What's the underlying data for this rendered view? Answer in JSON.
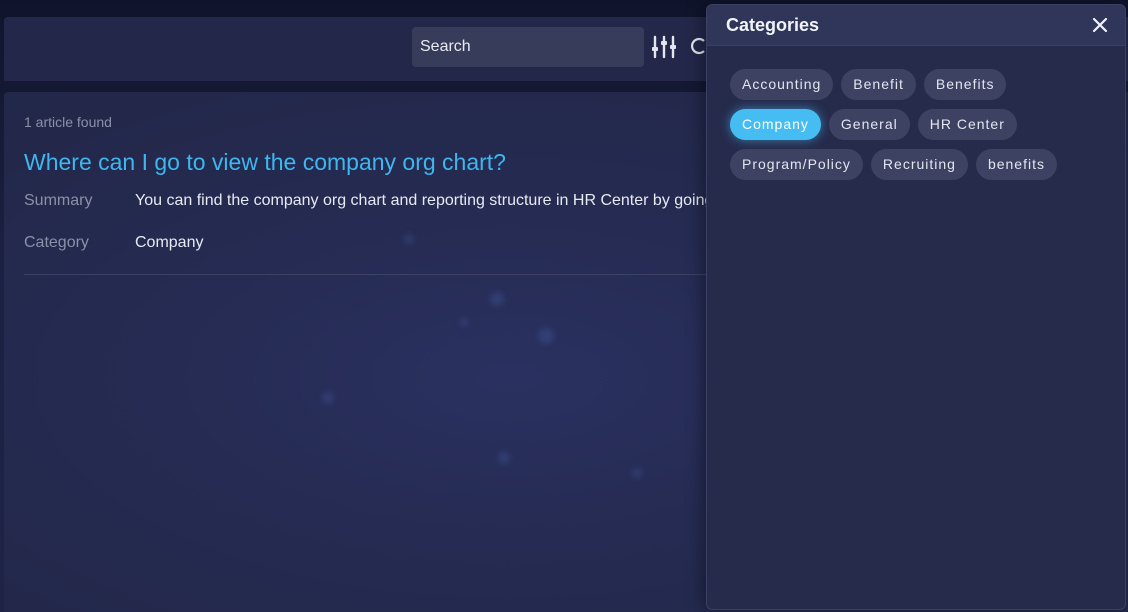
{
  "search": {
    "value": "Search",
    "filter_icon": "sliders-icon",
    "refresh_icon": "refresh-icon"
  },
  "results": {
    "count_text": "1 article found",
    "article": {
      "title": "Where can I go to view the company org chart?",
      "summary_label": "Summary",
      "summary_value": "You can find the company org chart and reporting structure in HR Center by going",
      "category_label": "Category",
      "category_value": "Company"
    }
  },
  "categories_panel": {
    "title": "Categories",
    "close_icon": "close-icon",
    "rows": [
      [
        {
          "label": "Accounting",
          "active": false
        },
        {
          "label": "Benefit",
          "active": false
        },
        {
          "label": "Benefits",
          "active": false
        }
      ],
      [
        {
          "label": "Company",
          "active": true
        },
        {
          "label": "General",
          "active": false
        },
        {
          "label": "HR Center",
          "active": false
        }
      ],
      [
        {
          "label": "Program/Policy",
          "active": false
        },
        {
          "label": "Recruiting",
          "active": false
        },
        {
          "label": "benefits",
          "active": false
        }
      ]
    ]
  },
  "colors": {
    "accent": "#45bdf2",
    "link": "#3fb6ee",
    "panel": "#262b4c",
    "background": "#1f2447"
  }
}
